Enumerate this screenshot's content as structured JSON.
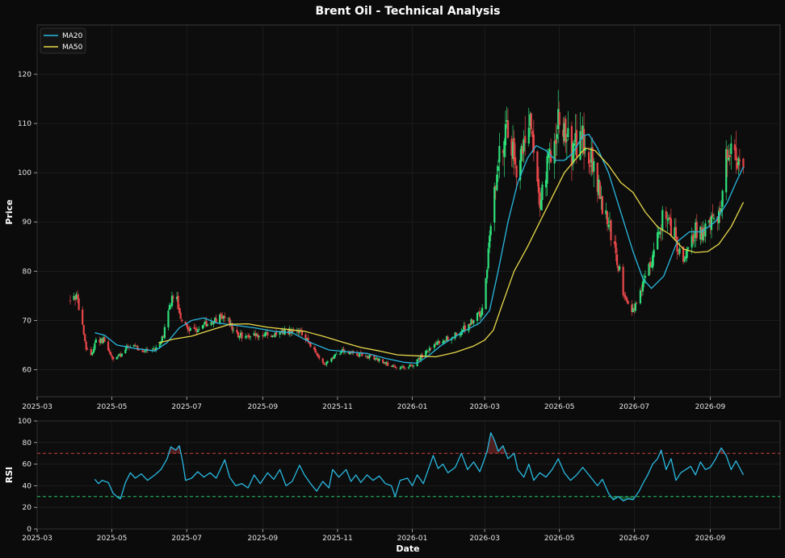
{
  "chart_data": [
    {
      "type": "candlestick",
      "title": "Brent Oil - Technical Analysis",
      "ylabel": "Price",
      "xlabel": "",
      "xlim": [
        "2025-03-01",
        "2026-10-28"
      ],
      "ylim": [
        54.5,
        130
      ],
      "x_ticks": [
        "2025-03",
        "2025-05",
        "2025-07",
        "2025-09",
        "2025-11",
        "2026-01",
        "2026-03",
        "2026-05",
        "2026-07",
        "2026-09"
      ],
      "y_ticks": [
        60,
        70,
        80,
        90,
        100,
        110,
        120
      ],
      "grid": true,
      "legend": {
        "placement": "top-left",
        "entries": [
          "MA20",
          "MA50"
        ]
      },
      "colors": {
        "up": "#2ee07a",
        "down": "#e8474a",
        "MA20": "#28b8e0",
        "MA50": "#e8d84a",
        "background": "#0b0b0b",
        "axes": "#0d0d0d"
      },
      "price_path": [
        [
          "2025-03-28",
          74
        ],
        [
          "2025-04-02",
          75
        ],
        [
          "2025-04-06",
          70
        ],
        [
          "2025-04-10",
          64
        ],
        [
          "2025-04-14",
          63
        ],
        [
          "2025-04-18",
          66
        ],
        [
          "2025-04-24",
          66
        ],
        [
          "2025-05-02",
          62
        ],
        [
          "2025-05-08",
          63
        ],
        [
          "2025-05-15",
          65
        ],
        [
          "2025-05-25",
          64
        ],
        [
          "2025-06-05",
          64
        ],
        [
          "2025-06-12",
          67
        ],
        [
          "2025-06-18",
          74
        ],
        [
          "2025-06-22",
          76
        ],
        [
          "2025-06-26",
          70
        ],
        [
          "2025-07-05",
          68
        ],
        [
          "2025-07-15",
          69
        ],
        [
          "2025-07-25",
          70
        ],
        [
          "2025-08-01",
          71
        ],
        [
          "2025-08-10",
          67
        ],
        [
          "2025-08-25",
          67
        ],
        [
          "2025-09-10",
          67
        ],
        [
          "2025-09-25",
          68
        ],
        [
          "2025-10-05",
          67
        ],
        [
          "2025-10-15",
          63
        ],
        [
          "2025-10-22",
          61
        ],
        [
          "2025-11-05",
          64
        ],
        [
          "2025-11-20",
          63
        ],
        [
          "2025-12-05",
          62
        ],
        [
          "2025-12-20",
          60
        ],
        [
          "2026-01-01",
          61
        ],
        [
          "2026-01-10",
          63
        ],
        [
          "2026-01-25",
          66
        ],
        [
          "2026-02-05",
          67
        ],
        [
          "2026-02-20",
          70
        ],
        [
          "2026-02-28",
          72
        ],
        [
          "2026-03-05",
          88
        ],
        [
          "2026-03-12",
          103
        ],
        [
          "2026-03-20",
          110
        ],
        [
          "2026-03-28",
          98
        ],
        [
          "2026-04-05",
          113
        ],
        [
          "2026-04-15",
          95
        ],
        [
          "2026-04-25",
          105
        ],
        [
          "2026-05-01",
          113
        ],
        [
          "2026-05-10",
          104
        ],
        [
          "2026-05-20",
          108
        ],
        [
          "2026-05-28",
          102
        ],
        [
          "2026-06-05",
          93
        ],
        [
          "2026-06-15",
          85
        ],
        [
          "2026-06-22",
          76
        ],
        [
          "2026-06-30",
          72
        ],
        [
          "2026-07-08",
          77
        ],
        [
          "2026-07-18",
          85
        ],
        [
          "2026-07-25",
          92
        ],
        [
          "2026-08-02",
          88
        ],
        [
          "2026-08-10",
          81
        ],
        [
          "2026-08-20",
          88
        ],
        [
          "2026-08-30",
          88
        ],
        [
          "2026-09-10",
          93
        ],
        [
          "2026-09-15",
          105
        ],
        [
          "2026-09-22",
          104
        ],
        [
          "2026-09-28",
          99
        ]
      ],
      "ma20": [
        [
          "2025-04-17",
          67.5
        ],
        [
          "2025-04-25",
          67
        ],
        [
          "2025-05-05",
          65
        ],
        [
          "2025-05-20",
          64.3
        ],
        [
          "2025-06-05",
          63.8
        ],
        [
          "2025-06-15",
          65.5
        ],
        [
          "2025-06-25",
          68.5
        ],
        [
          "2025-07-05",
          70
        ],
        [
          "2025-07-15",
          70.5
        ],
        [
          "2025-07-25",
          69.5
        ],
        [
          "2025-08-10",
          69
        ],
        [
          "2025-08-25",
          68.5
        ],
        [
          "2025-09-10",
          67.8
        ],
        [
          "2025-09-25",
          67.5
        ],
        [
          "2025-10-10",
          65.5
        ],
        [
          "2025-10-25",
          64
        ],
        [
          "2025-11-10",
          63.6
        ],
        [
          "2025-11-25",
          63.3
        ],
        [
          "2025-12-10",
          62.3
        ],
        [
          "2025-12-25",
          61.5
        ],
        [
          "2026-01-05",
          61.3
        ],
        [
          "2026-01-15",
          63
        ],
        [
          "2026-01-25",
          65
        ],
        [
          "2026-02-10",
          67.5
        ],
        [
          "2026-02-25",
          69.5
        ],
        [
          "2026-03-05",
          72
        ],
        [
          "2026-03-12",
          80
        ],
        [
          "2026-03-20",
          90
        ],
        [
          "2026-03-28",
          98
        ],
        [
          "2026-04-05",
          103
        ],
        [
          "2026-04-12",
          105.5
        ],
        [
          "2026-04-20",
          104.5
        ],
        [
          "2026-04-28",
          102.5
        ],
        [
          "2026-05-05",
          102.5
        ],
        [
          "2026-05-12",
          104
        ],
        [
          "2026-05-20",
          107.5
        ],
        [
          "2026-05-25",
          107.8
        ],
        [
          "2026-06-01",
          105
        ],
        [
          "2026-06-10",
          100
        ],
        [
          "2026-06-20",
          92
        ],
        [
          "2026-06-30",
          84
        ],
        [
          "2026-07-08",
          78.5
        ],
        [
          "2026-07-15",
          76.5
        ],
        [
          "2026-07-25",
          79
        ],
        [
          "2026-08-05",
          86
        ],
        [
          "2026-08-15",
          88
        ],
        [
          "2026-08-25",
          88
        ],
        [
          "2026-09-05",
          90
        ],
        [
          "2026-09-15",
          94
        ],
        [
          "2026-09-22",
          98
        ],
        [
          "2026-09-28",
          101.2
        ]
      ],
      "ma50": [
        [
          "2025-06-08",
          65.4
        ],
        [
          "2025-06-20",
          66.2
        ],
        [
          "2025-07-05",
          66.8
        ],
        [
          "2025-07-20",
          68
        ],
        [
          "2025-08-05",
          69.2
        ],
        [
          "2025-08-20",
          69.3
        ],
        [
          "2025-09-05",
          68.6
        ],
        [
          "2025-09-20",
          68.2
        ],
        [
          "2025-10-05",
          67.8
        ],
        [
          "2025-10-20",
          66.8
        ],
        [
          "2025-11-05",
          65.6
        ],
        [
          "2025-11-20",
          64.5
        ],
        [
          "2025-12-05",
          63.8
        ],
        [
          "2025-12-20",
          63
        ],
        [
          "2026-01-05",
          62.8
        ],
        [
          "2026-01-20",
          62.6
        ],
        [
          "2026-02-05",
          63.5
        ],
        [
          "2026-02-20",
          64.8
        ],
        [
          "2026-03-01",
          66
        ],
        [
          "2026-03-08",
          68
        ],
        [
          "2026-03-15",
          73
        ],
        [
          "2026-03-25",
          80
        ],
        [
          "2026-04-05",
          85
        ],
        [
          "2026-04-15",
          90
        ],
        [
          "2026-04-25",
          95
        ],
        [
          "2026-05-05",
          100
        ],
        [
          "2026-05-15",
          103
        ],
        [
          "2026-05-22",
          105
        ],
        [
          "2026-05-30",
          104.5
        ],
        [
          "2026-06-10",
          101.5
        ],
        [
          "2026-06-20",
          98
        ],
        [
          "2026-06-30",
          96
        ],
        [
          "2026-07-10",
          92
        ],
        [
          "2026-07-20",
          89
        ],
        [
          "2026-07-30",
          87.5
        ],
        [
          "2026-08-10",
          84.5
        ],
        [
          "2026-08-20",
          83.8
        ],
        [
          "2026-08-30",
          84
        ],
        [
          "2026-09-08",
          85.5
        ],
        [
          "2026-09-18",
          89
        ],
        [
          "2026-09-28",
          94
        ]
      ]
    },
    {
      "type": "line",
      "title": "",
      "xlabel": "Date",
      "ylabel": "RSI",
      "xlim": [
        "2025-03-01",
        "2026-10-28"
      ],
      "ylim": [
        0,
        100
      ],
      "x_ticks": [
        "2025-03",
        "2025-05",
        "2025-07",
        "2025-09",
        "2025-11",
        "2026-01",
        "2026-03",
        "2026-05",
        "2026-07",
        "2026-09"
      ],
      "y_ticks": [
        0,
        20,
        40,
        60,
        80,
        100
      ],
      "grid": true,
      "overbought": 70,
      "oversold": 30,
      "colors": {
        "rsi": "#28b8e0",
        "overbought": "#e8474a",
        "oversold": "#2ee07a"
      },
      "series": [
        {
          "points": [
            [
              "2025-04-17",
              46
            ],
            [
              "2025-04-20",
              42
            ],
            [
              "2025-04-23",
              45
            ],
            [
              "2025-04-28",
              43
            ],
            [
              "2025-05-02",
              33
            ],
            [
              "2025-05-06",
              29
            ],
            [
              "2025-05-08",
              28
            ],
            [
              "2025-05-12",
              43
            ],
            [
              "2025-05-16",
              52
            ],
            [
              "2025-05-20",
              47
            ],
            [
              "2025-05-25",
              51
            ],
            [
              "2025-05-30",
              45
            ],
            [
              "2025-06-05",
              50
            ],
            [
              "2025-06-10",
              55
            ],
            [
              "2025-06-15",
              65
            ],
            [
              "2025-06-18",
              76
            ],
            [
              "2025-06-22",
              73
            ],
            [
              "2025-06-25",
              77
            ],
            [
              "2025-06-28",
              60
            ],
            [
              "2025-06-30",
              45
            ],
            [
              "2025-07-05",
              47
            ],
            [
              "2025-07-10",
              53
            ],
            [
              "2025-07-15",
              48
            ],
            [
              "2025-07-20",
              52
            ],
            [
              "2025-07-25",
              47
            ],
            [
              "2025-08-01",
              64
            ],
            [
              "2025-08-05",
              48
            ],
            [
              "2025-08-10",
              40
            ],
            [
              "2025-08-15",
              42
            ],
            [
              "2025-08-20",
              38
            ],
            [
              "2025-08-25",
              50
            ],
            [
              "2025-08-30",
              42
            ],
            [
              "2025-09-05",
              52
            ],
            [
              "2025-09-10",
              46
            ],
            [
              "2025-09-15",
              55
            ],
            [
              "2025-09-20",
              40
            ],
            [
              "2025-09-25",
              44
            ],
            [
              "2025-10-01",
              59
            ],
            [
              "2025-10-05",
              50
            ],
            [
              "2025-10-10",
              42
            ],
            [
              "2025-10-15",
              35
            ],
            [
              "2025-10-20",
              44
            ],
            [
              "2025-10-25",
              38
            ],
            [
              "2025-10-28",
              55
            ],
            [
              "2025-11-02",
              48
            ],
            [
              "2025-11-08",
              55
            ],
            [
              "2025-11-12",
              44
            ],
            [
              "2025-11-16",
              50
            ],
            [
              "2025-11-20",
              43
            ],
            [
              "2025-11-25",
              50
            ],
            [
              "2025-11-30",
              45
            ],
            [
              "2025-12-05",
              49
            ],
            [
              "2025-12-10",
              42
            ],
            [
              "2025-12-15",
              40
            ],
            [
              "2025-12-18",
              30
            ],
            [
              "2025-12-22",
              45
            ],
            [
              "2025-12-28",
              47
            ],
            [
              "2026-01-01",
              40
            ],
            [
              "2026-01-05",
              50
            ],
            [
              "2026-01-10",
              42
            ],
            [
              "2026-01-14",
              55
            ],
            [
              "2026-01-18",
              68
            ],
            [
              "2026-01-22",
              56
            ],
            [
              "2026-01-26",
              60
            ],
            [
              "2026-01-30",
              52
            ],
            [
              "2026-02-05",
              57
            ],
            [
              "2026-02-10",
              70
            ],
            [
              "2026-02-15",
              55
            ],
            [
              "2026-02-20",
              62
            ],
            [
              "2026-02-25",
              53
            ],
            [
              "2026-02-28",
              62
            ],
            [
              "2026-03-03",
              72
            ],
            [
              "2026-03-06",
              89
            ],
            [
              "2026-03-09",
              82
            ],
            [
              "2026-03-12",
              72
            ],
            [
              "2026-03-16",
              77
            ],
            [
              "2026-03-20",
              65
            ],
            [
              "2026-03-25",
              70
            ],
            [
              "2026-03-28",
              55
            ],
            [
              "2026-04-02",
              48
            ],
            [
              "2026-04-06",
              60
            ],
            [
              "2026-04-10",
              45
            ],
            [
              "2026-04-15",
              52
            ],
            [
              "2026-04-20",
              48
            ],
            [
              "2026-04-25",
              55
            ],
            [
              "2026-04-30",
              65
            ],
            [
              "2026-05-05",
              52
            ],
            [
              "2026-05-10",
              45
            ],
            [
              "2026-05-15",
              50
            ],
            [
              "2026-05-20",
              57
            ],
            [
              "2026-05-25",
              50
            ],
            [
              "2026-06-01",
              40
            ],
            [
              "2026-06-05",
              46
            ],
            [
              "2026-06-10",
              33
            ],
            [
              "2026-06-14",
              27
            ],
            [
              "2026-06-18",
              30
            ],
            [
              "2026-06-22",
              26
            ],
            [
              "2026-06-26",
              28
            ],
            [
              "2026-06-30",
              27
            ],
            [
              "2026-07-05",
              35
            ],
            [
              "2026-07-08",
              42
            ],
            [
              "2026-07-12",
              50
            ],
            [
              "2026-07-16",
              60
            ],
            [
              "2026-07-20",
              65
            ],
            [
              "2026-07-23",
              73
            ],
            [
              "2026-07-27",
              55
            ],
            [
              "2026-07-31",
              65
            ],
            [
              "2026-08-04",
              45
            ],
            [
              "2026-08-08",
              52
            ],
            [
              "2026-08-12",
              55
            ],
            [
              "2026-08-16",
              58
            ],
            [
              "2026-08-20",
              50
            ],
            [
              "2026-08-24",
              62
            ],
            [
              "2026-08-28",
              55
            ],
            [
              "2026-09-01",
              57
            ],
            [
              "2026-09-05",
              64
            ],
            [
              "2026-09-10",
              75
            ],
            [
              "2026-09-14",
              68
            ],
            [
              "2026-09-18",
              55
            ],
            [
              "2026-09-22",
              63
            ],
            [
              "2026-09-28",
              50
            ]
          ]
        }
      ]
    }
  ]
}
